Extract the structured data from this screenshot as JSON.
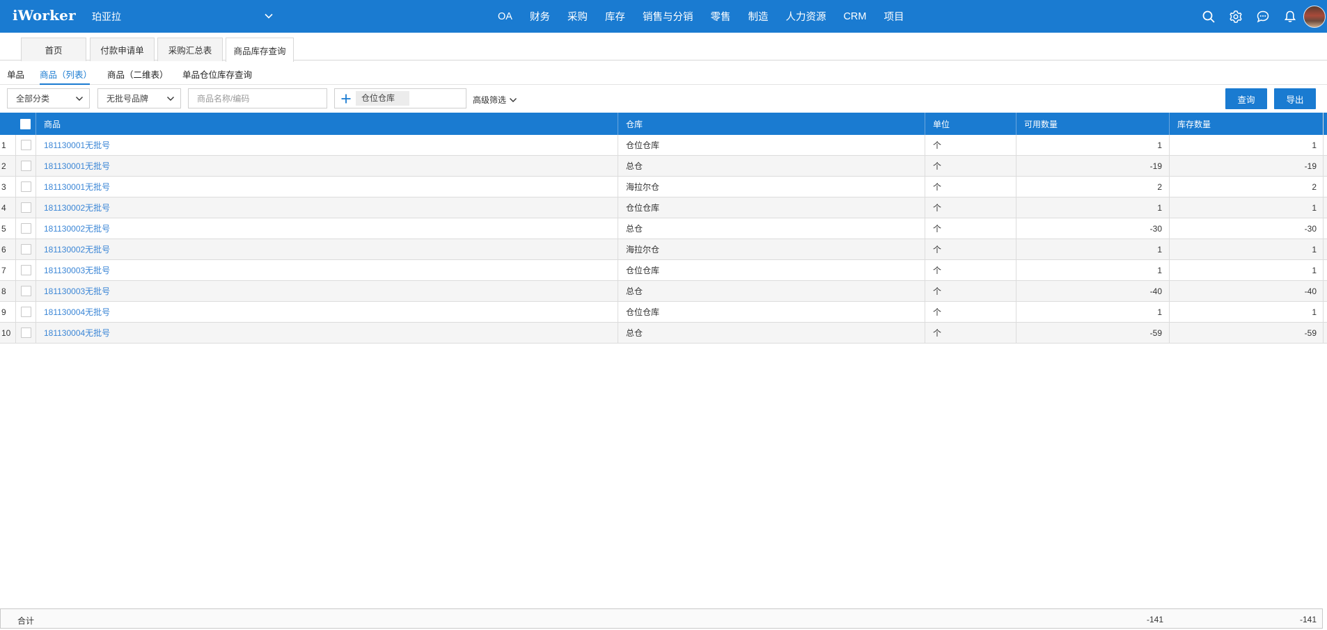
{
  "header": {
    "logo": "iWorker",
    "company": "珀亚拉",
    "nav": [
      "OA",
      "财务",
      "采购",
      "库存",
      "销售与分销",
      "零售",
      "制造",
      "人力资源",
      "CRM",
      "项目"
    ]
  },
  "icons": {
    "search": "search-icon",
    "settings": "gear-icon",
    "chat": "chat-icon",
    "notifications": "bell-icon"
  },
  "tabs": [
    "首页",
    "付款申请单",
    "采购汇总表",
    "商品库存查询"
  ],
  "subtabs": [
    "单品",
    "商品（列表）",
    "商品（二维表）",
    "单品仓位库存查询"
  ],
  "filters": {
    "category": "全部分类",
    "brand": "无批号品牌",
    "search_placeholder": "商品名称/编码",
    "warehouse_chip": "仓位仓库",
    "advanced": "高级筛选",
    "query_button": "查询",
    "export_button": "导出"
  },
  "table": {
    "columns": [
      "商品",
      "仓库",
      "单位",
      "可用数量",
      "库存数量"
    ],
    "rows": [
      {
        "index": "1",
        "product": "181130001无批号",
        "warehouse": "仓位仓库",
        "unit": "个",
        "available": "1",
        "stock": "1"
      },
      {
        "index": "2",
        "product": "181130001无批号",
        "warehouse": "总仓",
        "unit": "个",
        "available": "-19",
        "stock": "-19"
      },
      {
        "index": "3",
        "product": "181130001无批号",
        "warehouse": "海拉尔仓",
        "unit": "个",
        "available": "2",
        "stock": "2"
      },
      {
        "index": "4",
        "product": "181130002无批号",
        "warehouse": "仓位仓库",
        "unit": "个",
        "available": "1",
        "stock": "1"
      },
      {
        "index": "5",
        "product": "181130002无批号",
        "warehouse": "总仓",
        "unit": "个",
        "available": "-30",
        "stock": "-30"
      },
      {
        "index": "6",
        "product": "181130002无批号",
        "warehouse": "海拉尔仓",
        "unit": "个",
        "available": "1",
        "stock": "1"
      },
      {
        "index": "7",
        "product": "181130003无批号",
        "warehouse": "仓位仓库",
        "unit": "个",
        "available": "1",
        "stock": "1"
      },
      {
        "index": "8",
        "product": "181130003无批号",
        "warehouse": "总仓",
        "unit": "个",
        "available": "-40",
        "stock": "-40"
      },
      {
        "index": "9",
        "product": "181130004无批号",
        "warehouse": "仓位仓库",
        "unit": "个",
        "available": "1",
        "stock": "1"
      },
      {
        "index": "10",
        "product": "181130004无批号",
        "warehouse": "总仓",
        "unit": "个",
        "available": "-59",
        "stock": "-59"
      }
    ]
  },
  "footer": {
    "label": "合计",
    "available_total": "-141",
    "stock_total": "-141"
  }
}
